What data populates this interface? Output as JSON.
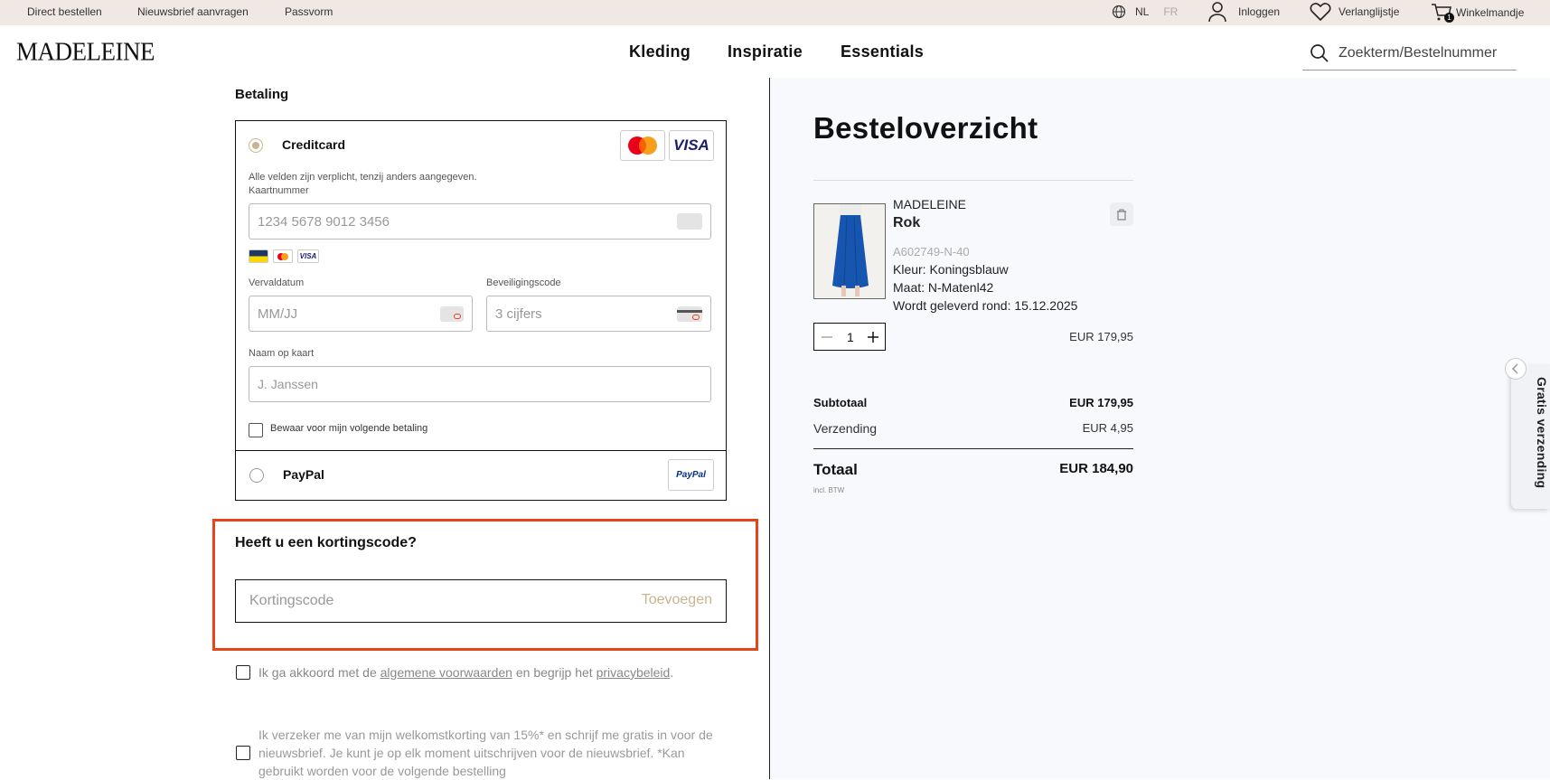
{
  "topbar": {
    "links": [
      "Direct bestellen",
      "Nieuwsbrief aanvragen",
      "Passvorm"
    ],
    "lang_active": "NL",
    "lang_other": "FR",
    "login": "Inloggen",
    "wishlist": "Verlanglijstje",
    "cart": "Winkelmandje",
    "cart_count": "1"
  },
  "header": {
    "logo": "MADELEINE",
    "nav": [
      "Kleding",
      "Inspiratie",
      "Essentials"
    ],
    "search_placeholder": "Zoekterm/Bestelnummer"
  },
  "payment": {
    "section_title": "Betaling",
    "creditcard": {
      "label": "Creditcard",
      "required_note": "Alle velden zijn verplicht, tenzij anders aangegeven.",
      "card_number_label": "Kaartnummer",
      "card_number_placeholder": "1234 5678 9012 3456",
      "expiry_label": "Vervaldatum",
      "expiry_placeholder": "MM/JJ",
      "cvc_label": "Beveiligingscode",
      "cvc_placeholder": "3 cijfers",
      "name_label": "Naam op kaart",
      "name_placeholder": "J. Janssen",
      "save_label": "Bewaar voor mijn volgende betaling",
      "brand_visa": "VISA",
      "brand_bancontact": "Bancontact"
    },
    "paypal": {
      "label": "PayPal",
      "logo_text": "PayPal"
    }
  },
  "discount": {
    "title": "Heeft u een kortingscode?",
    "placeholder": "Kortingscode",
    "add_label": "Toevoegen"
  },
  "terms": {
    "prefix": "Ik ga akkoord met de ",
    "link1": "algemene voorwaarden",
    "middle": " en begrijp het ",
    "link2": "privacybeleid",
    "suffix": ".",
    "newsletter": "Ik verzeker me van mijn welkomstkorting van 15%* en schrijf me gratis in voor de nieuwsbrief. Je kunt je op elk moment uitschrijven voor de nieuwsbrief. *Kan gebruikt worden voor de volgende bestelling"
  },
  "overview": {
    "title": "Besteloverzicht",
    "product": {
      "brand": "MADELEINE",
      "name": "Rok",
      "sku": "A602749-N-40",
      "color_label": "Kleur:",
      "color": "Koningsblauw",
      "size_label": "Maat:",
      "size": "N-Matenl42",
      "delivery_label": "Wordt geleverd rond:",
      "delivery": "15.12.2025",
      "quantity": "1",
      "price": "EUR 179,95"
    },
    "subtotal_label": "Subtotaal",
    "subtotal": "EUR 179,95",
    "shipping_label": "Verzending",
    "shipping": "EUR 4,95",
    "total_label": "Totaal",
    "total": "EUR 184,90",
    "vat_note": "incl. BTW"
  },
  "side_tab": {
    "label": "Gratis verzending"
  },
  "colors": {
    "accent": "#c8b58f",
    "highlight": "#e8441a",
    "skirt": "#1656b0"
  }
}
